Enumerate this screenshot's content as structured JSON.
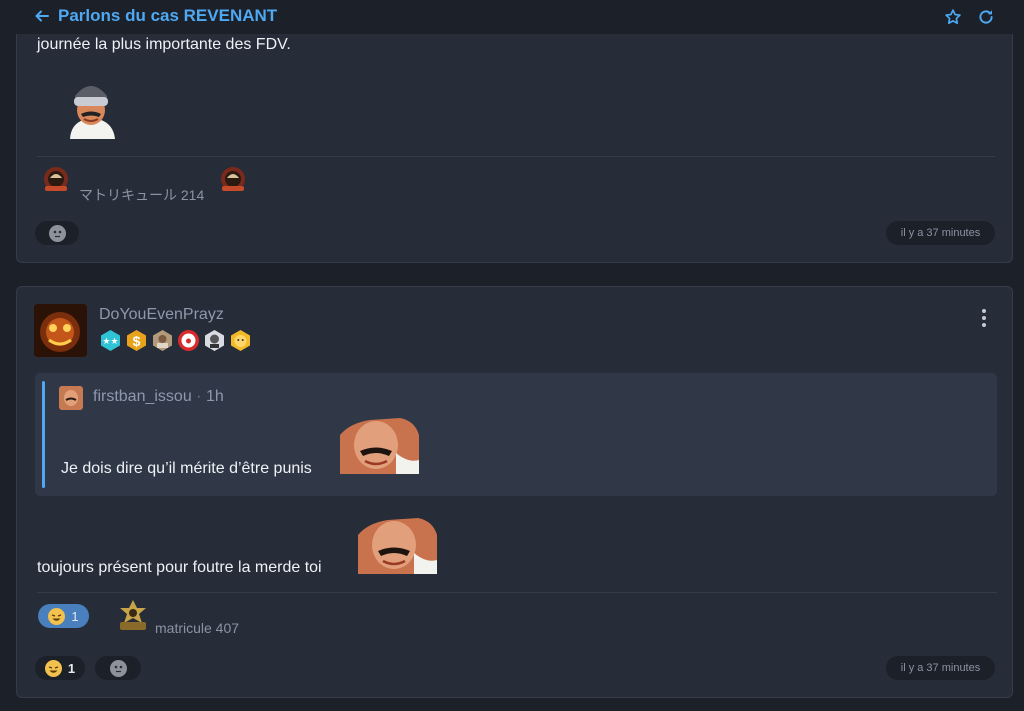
{
  "header": {
    "title": "Parlons du cas REVENANT",
    "back_icon": "arrow-left-icon",
    "star_icon": "star-icon",
    "refresh_icon": "refresh-icon",
    "accent_color": "#4ea8f2"
  },
  "post1": {
    "text_tail": "journée la plus importante des FDV.",
    "signature_text": "マトリキュール 214",
    "reaction_icon": "neutral-face-icon",
    "timestamp": "il y a 37 minutes"
  },
  "post2": {
    "username": "DoYouEvenPrayz",
    "badges": [
      "stars-badge",
      "dollar-badge",
      "photo-badge",
      "clown-badge",
      "face-badge",
      "emoji-badge"
    ],
    "quote": {
      "author": "firstban_issou",
      "age": "1h",
      "text": "Je dois dire qu’il mérite d’être punis"
    },
    "text": "toujours présent pour foutre la merde toi",
    "signature_reaction_count": "1",
    "signature_text": "matricule 407",
    "reactions": [
      {
        "icon": "laughing-face-icon",
        "count": "1"
      },
      {
        "icon": "neutral-face-icon",
        "count": ""
      }
    ],
    "timestamp": "il y a 37 minutes"
  }
}
